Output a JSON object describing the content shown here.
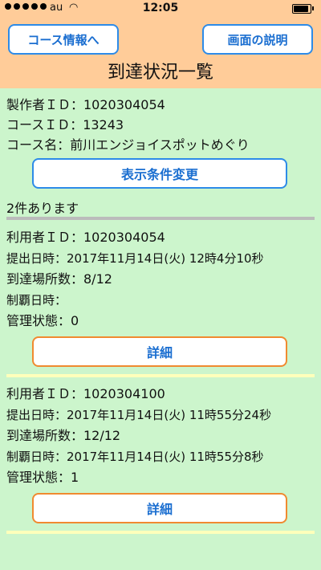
{
  "status_bar": {
    "carrier": "au",
    "time": "12:05",
    "battery_level": 0.9
  },
  "header": {
    "course_info_button": "コース情報へ",
    "help_button": "画面の説明",
    "title": "到達状況一覧"
  },
  "course": {
    "creator_line": "製作者ＩＤ：1020304054",
    "course_id_line": "コースＩＤ：13243",
    "course_name_line": "コース名：前川エンジョイスポットめぐり"
  },
  "filter_button": "表示条件変更",
  "count_text": "2件あります",
  "records": [
    {
      "user": "利用者ＩＤ：1020304054",
      "submitted": "提出日時：2017年11月14日(火) 12時4分10秒",
      "reached": "到達場所数：8/12",
      "conquered": "制覇日時：",
      "status": "管理状態：0",
      "detail_button": "詳細"
    },
    {
      "user": "利用者ＩＤ：1020304100",
      "submitted": "提出日時：2017年11月14日(火) 11時55分24秒",
      "reached": "到達場所数：12/12",
      "conquered": "制覇日時：2017年11月14日(火) 11時55分8秒",
      "status": "管理状態：1",
      "detail_button": "詳細"
    }
  ],
  "colors": {
    "header_bg": "#ffcc99",
    "page_bg": "#ccf5cc",
    "blue_accent": "#2d8be8",
    "orange_accent": "#f08a30"
  }
}
